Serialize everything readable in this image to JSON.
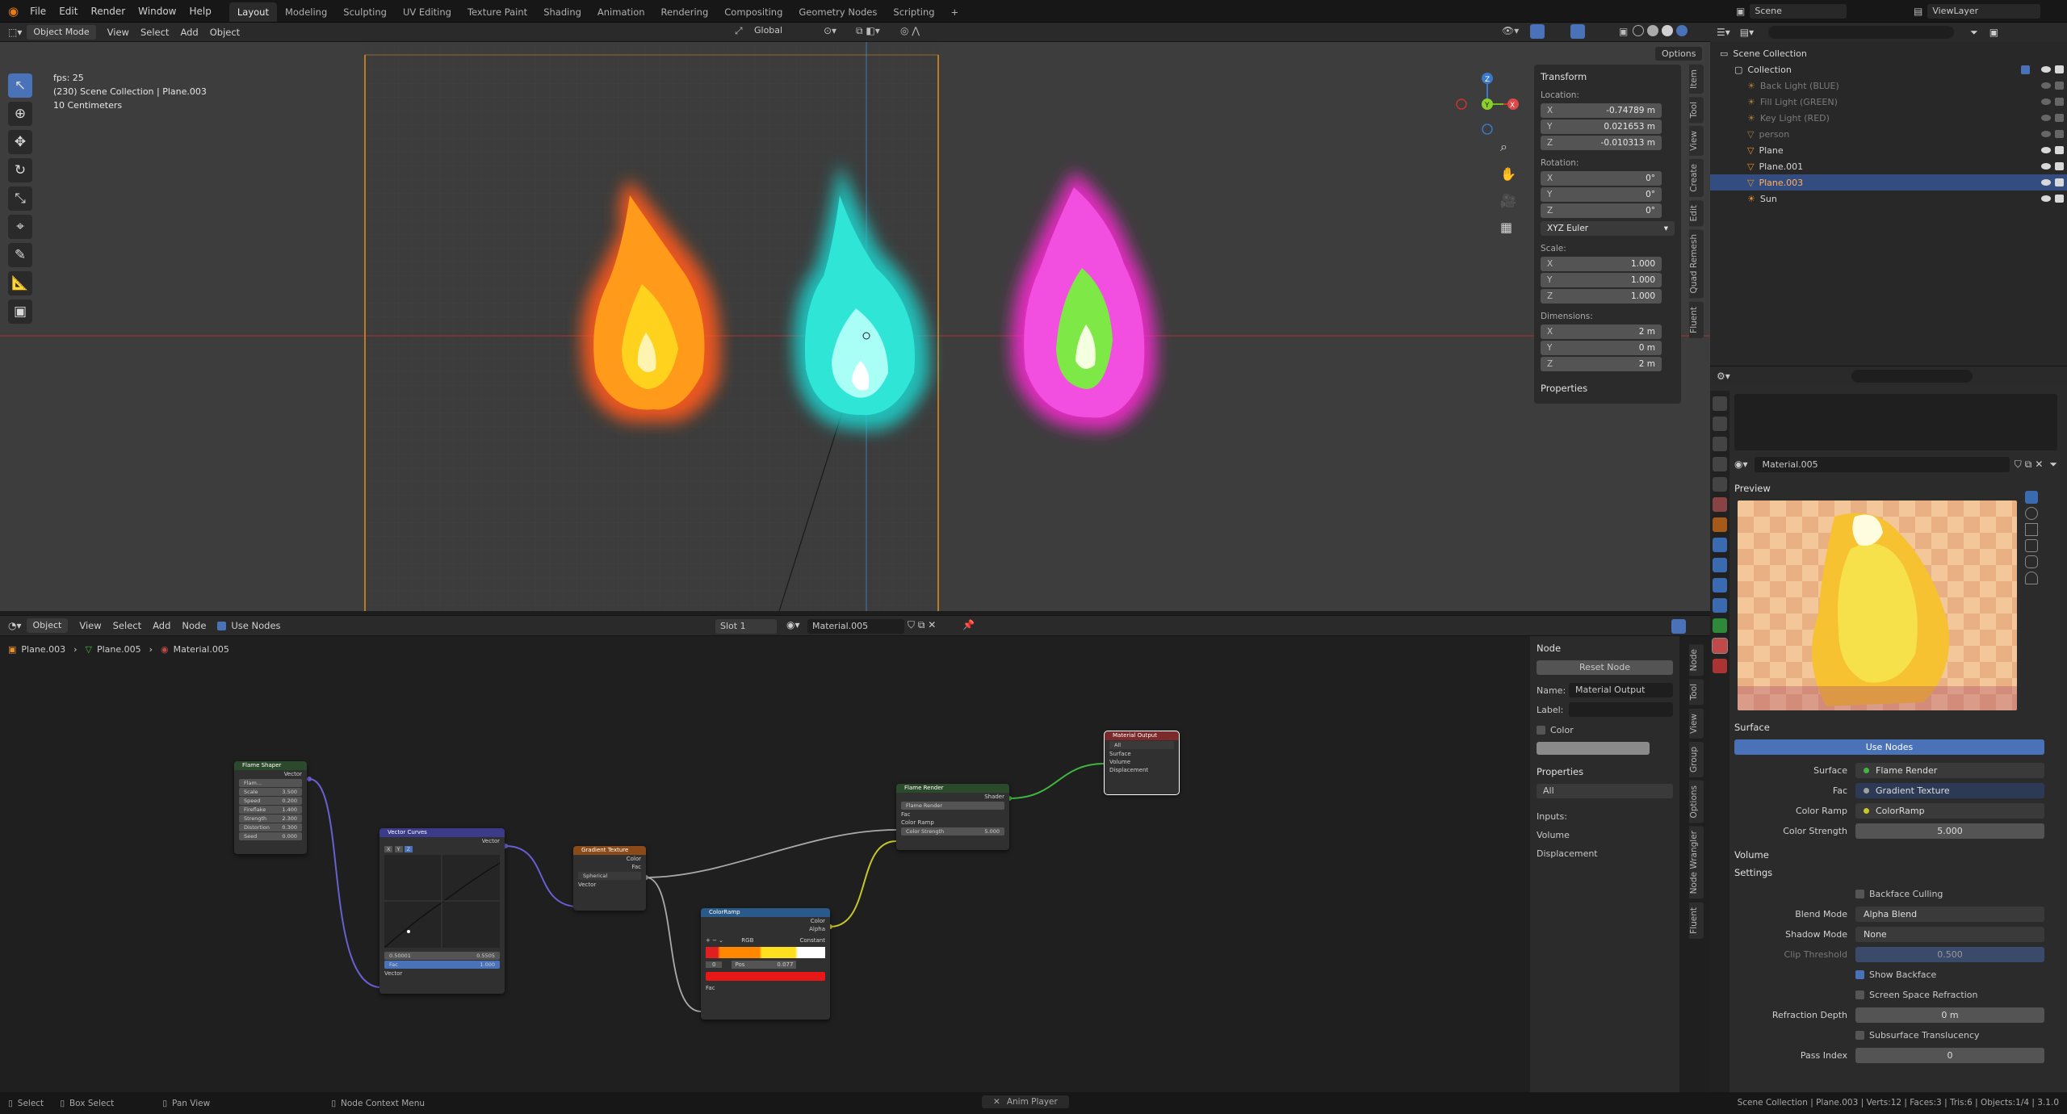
{
  "app": {
    "accent": "#4a72b8",
    "selection": "#334d80"
  },
  "menu": [
    "File",
    "Edit",
    "Render",
    "Window",
    "Help"
  ],
  "workspaces": [
    {
      "label": "Layout",
      "active": true
    },
    {
      "label": "Modeling"
    },
    {
      "label": "Sculpting"
    },
    {
      "label": "UV Editing"
    },
    {
      "label": "Texture Paint"
    },
    {
      "label": "Shading"
    },
    {
      "label": "Animation"
    },
    {
      "label": "Rendering"
    },
    {
      "label": "Compositing"
    },
    {
      "label": "Geometry Nodes"
    },
    {
      "label": "Scripting"
    }
  ],
  "scene": {
    "name": "Scene",
    "view_layer": "ViewLayer"
  },
  "viewport": {
    "mode": "Object Mode",
    "menus": [
      "View",
      "Select",
      "Add",
      "Object"
    ],
    "orientation": "Global",
    "options_label": "Options",
    "overlay": [
      "fps: 25",
      "(230) Scene Collection | Plane.003",
      "10 Centimeters"
    ],
    "side_tabs": [
      "Item",
      "Tool",
      "View",
      "Create",
      "Edit",
      "Quad Remesh",
      "Fluent"
    ]
  },
  "npanel": {
    "transform_title": "Transform",
    "location_label": "Location:",
    "location": [
      {
        "axis": "X",
        "value": "-0.74789 m"
      },
      {
        "axis": "Y",
        "value": "0.021653 m"
      },
      {
        "axis": "Z",
        "value": "-0.010313 m"
      }
    ],
    "rotation_label": "Rotation:",
    "rotation": [
      {
        "axis": "X",
        "value": "0°"
      },
      {
        "axis": "Y",
        "value": "0°"
      },
      {
        "axis": "Z",
        "value": "0°"
      }
    ],
    "rotation_mode": "XYZ Euler",
    "scale_label": "Scale:",
    "scale": [
      {
        "axis": "X",
        "value": "1.000"
      },
      {
        "axis": "Y",
        "value": "1.000"
      },
      {
        "axis": "Z",
        "value": "1.000"
      }
    ],
    "dimensions_label": "Dimensions:",
    "dimensions": [
      {
        "axis": "X",
        "value": "2 m"
      },
      {
        "axis": "Y",
        "value": "0 m"
      },
      {
        "axis": "Z",
        "value": "2 m"
      }
    ],
    "properties_label": "Properties"
  },
  "outliner": {
    "root": "Scene Collection",
    "items": [
      {
        "label": "Collection",
        "kind": "collection"
      },
      {
        "label": "Back Light (BLUE)",
        "kind": "light",
        "dim": true
      },
      {
        "label": "Fill Light (GREEN)",
        "kind": "light",
        "dim": true
      },
      {
        "label": "Key Light (RED)",
        "kind": "light",
        "dim": true
      },
      {
        "label": "person",
        "kind": "mesh",
        "dim": true
      },
      {
        "label": "Plane",
        "kind": "mesh"
      },
      {
        "label": "Plane.001",
        "kind": "mesh"
      },
      {
        "label": "Plane.003",
        "kind": "mesh",
        "selected": true
      },
      {
        "label": "Sun",
        "kind": "light"
      }
    ]
  },
  "properties": {
    "material": "Material.005",
    "preview_label": "Preview",
    "surface_section": "Surface",
    "use_nodes": "Use Nodes",
    "surface": {
      "label": "Surface",
      "value": "Flame Render"
    },
    "fac": {
      "label": "Fac",
      "value": "Gradient Texture"
    },
    "color_ramp": {
      "label": "Color Ramp",
      "value": "ColorRamp"
    },
    "color_strength": {
      "label": "Color Strength",
      "value": "5.000"
    },
    "volume_section": "Volume",
    "settings_section": "Settings",
    "backface_culling": "Backface Culling",
    "blend_mode": {
      "label": "Blend Mode",
      "value": "Alpha Blend"
    },
    "shadow_mode": {
      "label": "Shadow Mode",
      "value": "None"
    },
    "clip_threshold": {
      "label": "Clip Threshold",
      "value": "0.500"
    },
    "show_backface": "Show Backface",
    "ssr": "Screen Space Refraction",
    "refraction_depth": {
      "label": "Refraction Depth",
      "value": "0 m"
    },
    "subsurface": "Subsurface Translucency",
    "pass_index": {
      "label": "Pass Index",
      "value": "0"
    }
  },
  "node_editor": {
    "type_menu": "Object",
    "menus": [
      "View",
      "Select",
      "Add",
      "Node"
    ],
    "use_nodes": "Use Nodes",
    "slot": "Slot 1",
    "material": "Material.005",
    "breadcrumb": [
      "Plane.003",
      "Plane.005",
      "Material.005"
    ],
    "side_tabs": [
      "Node",
      "Tool",
      "View",
      "Group",
      "Options",
      "Node Wrangler",
      "Fluent"
    ],
    "side": {
      "title": "Node",
      "reset": "Reset Node",
      "name_label": "Name:",
      "name_value": "Material Output",
      "label_label": "Label:",
      "color_label": "Color",
      "properties_title": "Properties",
      "target": "All",
      "inputs_label": "Inputs:",
      "inputs": [
        "Volume",
        "Displacement"
      ]
    },
    "nodes": {
      "flame_shaper": {
        "title": "Flame Shaper",
        "out": "Vector",
        "sel": "Flam...",
        "rows": [
          [
            "Scale",
            "3.500"
          ],
          [
            "Speed",
            "0.200"
          ],
          [
            "Fireflake",
            "1.400"
          ],
          [
            "Strength",
            "2.300"
          ],
          [
            "Distortion",
            "0.300"
          ],
          [
            "Seed",
            "0.000"
          ]
        ]
      },
      "vector_curves": {
        "title": "Vector Curves",
        "out": "Vector",
        "xyz": [
          "X",
          "Y",
          "Z"
        ],
        "point": [
          "0.50001",
          "0.5505"
        ],
        "fac": [
          "Fac",
          "1.000"
        ],
        "in": "Vector"
      },
      "gradient": {
        "title": "Gradient Texture",
        "outs": [
          "Color",
          "Fac"
        ],
        "type": "Spherical",
        "in": "Vector"
      },
      "colorramp": {
        "title": "ColorRamp",
        "outs": [
          "Color",
          "Alpha"
        ],
        "mode": "RGB",
        "interp": "Constant",
        "idx": "0",
        "pos_label": "Pos",
        "pos": "0.077",
        "in": "Fac"
      },
      "flame_render": {
        "title": "Flame Render",
        "out": "Shader",
        "sel": "Flame Render",
        "ins": [
          "Fac",
          "Color Ramp"
        ],
        "strength": [
          "Color Strength",
          "5.000"
        ]
      },
      "material_output": {
        "title": "Material Output",
        "target": "All",
        "ins": [
          "Surface",
          "Volume",
          "Displacement"
        ]
      }
    }
  },
  "statusbar": {
    "items": [
      "Select",
      "Box Select",
      "Pan View",
      "Node Context Menu"
    ],
    "center": "Anim Player",
    "right": "Scene Collection | Plane.003 | Verts:12 | Faces:3 | Tris:6 | Objects:1/4 | 3.1.0"
  }
}
